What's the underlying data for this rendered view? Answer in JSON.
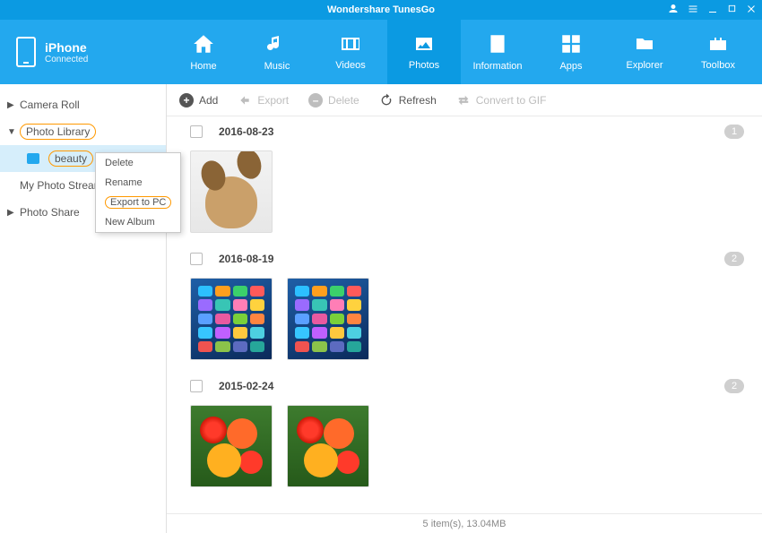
{
  "app": {
    "title": "Wondershare TunesGo"
  },
  "device": {
    "name": "iPhone",
    "status": "Connected"
  },
  "nav": {
    "home": "Home",
    "music": "Music",
    "videos": "Videos",
    "photos": "Photos",
    "information": "Information",
    "apps": "Apps",
    "explorer": "Explorer",
    "toolbox": "Toolbox"
  },
  "sidebar": {
    "camera_roll": "Camera Roll",
    "photo_library": "Photo Library",
    "album_beauty": "beauty",
    "my_photo_stream": "My Photo Stream",
    "photo_share": "Photo Share"
  },
  "contextMenu": {
    "delete": "Delete",
    "rename": "Rename",
    "export_to_pc": "Export to PC",
    "new_album": "New Album"
  },
  "toolbar": {
    "add": "Add",
    "export": "Export",
    "delete": "Delete",
    "refresh": "Refresh",
    "convert_gif": "Convert to GIF"
  },
  "groups": [
    {
      "date": "2016-08-23",
      "count": "1"
    },
    {
      "date": "2016-08-19",
      "count": "2"
    },
    {
      "date": "2015-02-24",
      "count": "2"
    }
  ],
  "status": "5 item(s), 13.04MB",
  "appColors": [
    "#2cc0ff",
    "#ff9f1e",
    "#3bd06b",
    "#ff5a5a",
    "#9a6bff",
    "#38c5b5",
    "#ff7eb6",
    "#ffd23e",
    "#5aa0ff",
    "#e85aa0",
    "#7ad03a",
    "#ff8540",
    "#37c6ff",
    "#c060ff",
    "#ffc83e",
    "#4dd0e1",
    "#ef5350",
    "#8bc34a",
    "#5c6bc0",
    "#26a69a"
  ]
}
